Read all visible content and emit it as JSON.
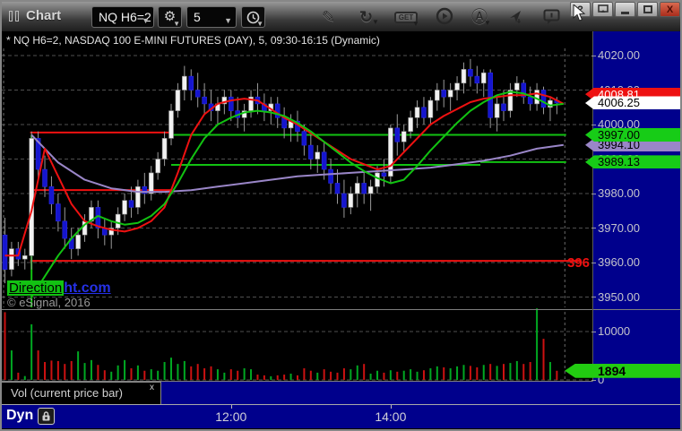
{
  "window": {
    "title": "Chart",
    "help_label": "?",
    "close_label": "X"
  },
  "toolbar": {
    "symbol": "NQ H6=2",
    "interval": "5",
    "get_label": "GET",
    "icons": [
      "window-icon",
      "gear-icon",
      "clock-icon",
      "pencil-icon",
      "refresh-icon",
      "get-icon",
      "play-icon",
      "auto-a-icon",
      "send-icon",
      "chat-icon"
    ]
  },
  "chart": {
    "title": "* NQ H6=2, NASDAQ 100 E-MINI FUTURES (DAY), 5, 09:30-16:15 (Dynamic)",
    "watermark_highlight": "Direction",
    "watermark_rest": "ht.com",
    "copyright": "© eSignal, 2016",
    "red_line_label": "396"
  },
  "indicator_tab": {
    "label": "Vol (current price bar)",
    "close": "x"
  },
  "bottom_bar": {
    "mode": "Dyn"
  },
  "colors": {
    "navy": "#00008c",
    "up": "#f2f2f2",
    "down": "#1515cf",
    "wick": "#9a9a9a",
    "red": "#ee1111",
    "green": "#12c212",
    "purple": "#9a86c8",
    "grid": "#4f4f4f",
    "axis_text": "#c4c4cc",
    "vol_up": "#00a822",
    "vol_down": "#cc1111"
  },
  "chart_data": {
    "type": "candlestick",
    "title": "NQ H6=2, NASDAQ 100 E-MINI FUTURES (DAY), 5, 09:30-16:15 (Dynamic)",
    "symbol": "NQ H6=2",
    "interval_minutes": 5,
    "session": "09:30-16:15",
    "ylim": [
      3944,
      4024
    ],
    "volume_ylim": [
      0,
      15000
    ],
    "grid": "dashed",
    "price_ticks": [
      {
        "label": "4020.00",
        "value": 4020
      },
      {
        "label": "4010.00",
        "value": 4010
      },
      {
        "label": "4000.00",
        "value": 4000
      },
      {
        "label": "3990.00",
        "value": 3990
      },
      {
        "label": "3980.00",
        "value": 3980
      },
      {
        "label": "3970.00",
        "value": 3970
      },
      {
        "label": "3960.00",
        "value": 3960
      },
      {
        "label": "3950.00",
        "value": 3950
      }
    ],
    "price_tags": [
      {
        "text": "3994.10",
        "price": 3994.1,
        "bg": "#9a86c8",
        "fg": "#000000",
        "series": "purple-ma"
      },
      {
        "text": "3997.00",
        "price": 3997.0,
        "bg": "#17cc17",
        "fg": "#000000",
        "series": "green-level"
      },
      {
        "text": "3989.13",
        "price": 3989.13,
        "bg": "#17cc17",
        "fg": "#000000",
        "series": "green-level"
      },
      {
        "text": "4008.81",
        "price": 4008.81,
        "bg": "#ee1111",
        "fg": "#ffffff",
        "series": "ask"
      },
      {
        "text": "4006.25",
        "price": 4006.25,
        "bg": "#ffffff",
        "fg": "#000000",
        "series": "last"
      }
    ],
    "volume_ticks": [
      {
        "label": "10000",
        "value": 10000
      },
      {
        "label": "0",
        "value": 0
      }
    ],
    "current_volume_tag": {
      "text": "1894",
      "value": 1894,
      "bg": "#22cc11",
      "fg": "#000000"
    },
    "x_ticks": [
      {
        "label": "12:00",
        "bar": 34
      },
      {
        "label": "14:00",
        "bar": 58
      }
    ],
    "session_vline": {
      "bar": 4,
      "from_price": 3997,
      "color": "green"
    },
    "markers": {
      "left_dashed_bar": -0.2,
      "right_dashed_bar": 84.2
    },
    "levels": [
      {
        "color": "red",
        "price": 3997.7,
        "from_bar": 3.8,
        "to_bar": 25
      },
      {
        "color": "green",
        "price": 3997.0,
        "from_bar": 25,
        "to_bar": 84.4
      },
      {
        "color": "red",
        "price": 3981.0,
        "from_bar": 3.8,
        "to_bar": 25
      },
      {
        "color": "green",
        "price": 3988.3,
        "from_bar": 25,
        "to_bar": 71.5
      },
      {
        "color": "green",
        "price": 3989.13,
        "from_bar": 71.5,
        "to_bar": 84.4
      },
      {
        "color": "red",
        "price": 3960.5,
        "from_bar": 3.8,
        "to_bar": 86.5,
        "label": "396"
      }
    ],
    "ohlc": [
      [
        3968,
        3973,
        3954,
        3958
      ],
      [
        3958,
        3966,
        3956,
        3964
      ],
      [
        3964,
        3966,
        3959,
        3961
      ],
      [
        3961,
        3964,
        3958,
        3962
      ],
      [
        3962,
        3998,
        3958,
        3996
      ],
      [
        3996,
        3998,
        3984,
        3987
      ],
      [
        3987,
        3991,
        3979,
        3982
      ],
      [
        3982,
        3985,
        3974,
        3977
      ],
      [
        3977,
        3980,
        3969,
        3972
      ],
      [
        3972,
        3976,
        3964,
        3967
      ],
      [
        3967,
        3970,
        3961,
        3964
      ],
      [
        3964,
        3970,
        3962,
        3968
      ],
      [
        3968,
        3974,
        3966,
        3972
      ],
      [
        3972,
        3978,
        3970,
        3976
      ],
      [
        3976,
        3978,
        3967,
        3970
      ],
      [
        3970,
        3973,
        3965,
        3968
      ],
      [
        3968,
        3972,
        3964,
        3970
      ],
      [
        3970,
        3976,
        3968,
        3974
      ],
      [
        3974,
        3980,
        3972,
        3978
      ],
      [
        3978,
        3982,
        3973,
        3976
      ],
      [
        3976,
        3984,
        3974,
        3982
      ],
      [
        3982,
        3986,
        3977,
        3980
      ],
      [
        3980,
        3988,
        3978,
        3986
      ],
      [
        3986,
        3992,
        3984,
        3990
      ],
      [
        3990,
        3998,
        3988,
        3996
      ],
      [
        3996,
        4006,
        3994,
        4004
      ],
      [
        4004,
        4012,
        4002,
        4010
      ],
      [
        4010,
        4017,
        4007,
        4014
      ],
      [
        4014,
        4016,
        4007,
        4010
      ],
      [
        4010,
        4015,
        4005,
        4008
      ],
      [
        4008,
        4012,
        4003,
        4006
      ],
      [
        4006,
        4010,
        4001,
        4004
      ],
      [
        4004,
        4008,
        4000,
        4006
      ],
      [
        4006,
        4010,
        4003,
        4008
      ],
      [
        4008,
        4010,
        4001,
        4004
      ],
      [
        4004,
        4008,
        3999,
        4002
      ],
      [
        4002,
        4006,
        3998,
        4004
      ],
      [
        4004,
        4010,
        4002,
        4008
      ],
      [
        4008,
        4012,
        4003,
        4006
      ],
      [
        4006,
        4009,
        4001,
        4004
      ],
      [
        4004,
        4008,
        4000,
        4006
      ],
      [
        4006,
        4008,
        3999,
        4002
      ],
      [
        4002,
        4005,
        3996,
        3999
      ],
      [
        3999,
        4003,
        3995,
        4001
      ],
      [
        4001,
        4004,
        3995,
        3998
      ],
      [
        3998,
        4000,
        3991,
        3994
      ],
      [
        3994,
        3997,
        3987,
        3990
      ],
      [
        3990,
        3994,
        3986,
        3992
      ],
      [
        3992,
        3995,
        3984,
        3987
      ],
      [
        3987,
        3990,
        3980,
        3983
      ],
      [
        3983,
        3987,
        3977,
        3980
      ],
      [
        3980,
        3984,
        3973,
        3976
      ],
      [
        3976,
        3982,
        3974,
        3980
      ],
      [
        3980,
        3985,
        3976,
        3983
      ],
      [
        3983,
        3986,
        3977,
        3980
      ],
      [
        3980,
        3984,
        3975,
        3982
      ],
      [
        3982,
        3988,
        3980,
        3986
      ],
      [
        3986,
        3990,
        3982,
        3985
      ],
      [
        3985,
        4000,
        3983,
        3999
      ],
      [
        3999,
        4003,
        3991,
        3995
      ],
      [
        3995,
        4000,
        3992,
        3998
      ],
      [
        3998,
        4004,
        3996,
        4002
      ],
      [
        4002,
        4007,
        3999,
        4005
      ],
      [
        4005,
        4008,
        4000,
        4002
      ],
      [
        4002,
        4008,
        4000,
        4007
      ],
      [
        4007,
        4012,
        4004,
        4010
      ],
      [
        4010,
        4013,
        4005,
        4008
      ],
      [
        4008,
        4012,
        4004,
        4010
      ],
      [
        4010,
        4014,
        4007,
        4012
      ],
      [
        4012,
        4018,
        4009,
        4016
      ],
      [
        4016,
        4019,
        4011,
        4014
      ],
      [
        4014,
        4017,
        4009,
        4012
      ],
      [
        4012,
        4016,
        4008,
        4015
      ],
      [
        4015,
        4016,
        3999,
        4002
      ],
      [
        4002,
        4008,
        3998,
        4006
      ],
      [
        4006,
        4010,
        4001,
        4004
      ],
      [
        4004,
        4012,
        4002,
        4010
      ],
      [
        4010,
        4014,
        4008,
        4012
      ],
      [
        4012,
        4013,
        4006,
        4008
      ],
      [
        4008,
        4011,
        4004,
        4006
      ],
      [
        4006,
        4012,
        4004,
        4010
      ],
      [
        4010,
        4011,
        4003,
        4005
      ],
      [
        4005,
        4008,
        4001,
        4007
      ],
      [
        4007,
        4008,
        4003,
        4006.25
      ]
    ],
    "volume": [
      14000,
      6100,
      1500,
      800,
      11500,
      6100,
      3700,
      4000,
      3900,
      3300,
      3900,
      5900,
      3500,
      4100,
      3100,
      2000,
      1700,
      3000,
      4100,
      2400,
      3000,
      1900,
      2200,
      1900,
      3700,
      4600,
      3300,
      3900,
      2800,
      3300,
      2400,
      2800,
      2200,
      1500,
      2200,
      1900,
      2400,
      2200,
      1100,
      950,
      750,
      950,
      1100,
      1300,
      950,
      2400,
      1900,
      1500,
      2200,
      1700,
      1500,
      2400,
      2200,
      3000,
      3300,
      1300,
      1900,
      1500,
      2000,
      1700,
      1900,
      2200,
      1700,
      2000,
      2400,
      2800,
      2600,
      2400,
      2800,
      3100,
      2900,
      2600,
      3100,
      3300,
      2900,
      3300,
      3500,
      3900,
      3300,
      3700,
      14800,
      8500,
      3700,
      1894
    ],
    "ma": {
      "purple": {
        "name": "slow-ma",
        "start_bar": 4,
        "step": 4,
        "prices": [
          3997,
          3989,
          3984,
          3981.5,
          3980.5,
          3980.5,
          3981,
          3982,
          3983,
          3984,
          3985,
          3985.5,
          3986,
          3986.5,
          3987,
          3987.5,
          3988.5,
          3989.5,
          3991,
          3993,
          3994.1
        ]
      },
      "red": {
        "name": "fast-ma",
        "start_bar": 0,
        "step": 2,
        "prices": [
          3962,
          3962,
          3975,
          3993,
          3985,
          3977,
          3972,
          3970.5,
          3969.5,
          3969,
          3970,
          3972,
          3976,
          3986,
          3997,
          4003,
          4006,
          4007,
          4007.5,
          4007,
          4004.5,
          4002,
          4000,
          3997.5,
          3995,
          3992.5,
          3990,
          3988.5,
          3987,
          3988,
          3992,
          3996,
          4000,
          4002.5,
          4004.5,
          4006.5,
          4007.5,
          4008,
          4008.5,
          4008.5,
          4009,
          4008,
          4006
        ]
      },
      "green": {
        "name": "mid-ma",
        "start_bar": 4,
        "step": 2,
        "prices": [
          3950,
          3956,
          3962,
          3967,
          3971,
          3973.5,
          3972,
          3971,
          3971.5,
          3973.5,
          3977,
          3983,
          3990,
          3996,
          4000,
          4002,
          4003.5,
          4004,
          4003.5,
          4002.5,
          4000.5,
          3998,
          3995,
          3992,
          3989,
          3986.5,
          3984.5,
          3983,
          3984,
          3988,
          3992.5,
          3996.5,
          4000.5,
          4004,
          4006.5,
          4008.5,
          4009.5,
          4009,
          4007.5,
          4005.5,
          4006
        ]
      }
    }
  }
}
